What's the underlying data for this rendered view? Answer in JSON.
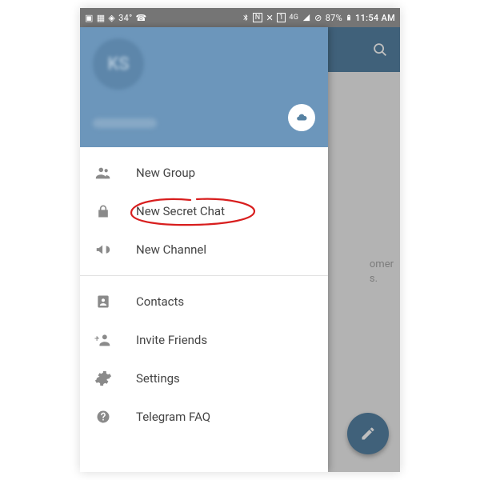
{
  "statusbar": {
    "left_icons": [
      "app-icon",
      "image-icon",
      "shield-icon",
      "temp-34",
      "phone-icon"
    ],
    "temp_text": "34°",
    "right": {
      "bt": "bluetooth-icon",
      "nfc_label": "N",
      "vibrate": "vibrate-icon",
      "data_label": "1",
      "signal_label": "4G",
      "signal": "signal-icon",
      "noloc": "location-off-icon",
      "battery_text": "87%",
      "battery": "battery-icon",
      "time": "11:54 AM"
    }
  },
  "appbar": {
    "search_icon": "search-icon"
  },
  "underlay": {
    "line1": "omer",
    "line2": "s."
  },
  "drawer": {
    "avatar_initials": "KS",
    "cloud_icon": "cloud-icon",
    "items": [
      {
        "icon": "group-icon",
        "label": "New Group"
      },
      {
        "icon": "lock-icon",
        "label": "New Secret Chat"
      },
      {
        "icon": "megaphone-icon",
        "label": "New Channel"
      }
    ],
    "items2": [
      {
        "icon": "contact-icon",
        "label": "Contacts"
      },
      {
        "icon": "add-person-icon",
        "label": "Invite Friends"
      },
      {
        "icon": "gear-icon",
        "label": "Settings"
      },
      {
        "icon": "help-icon",
        "label": "Telegram FAQ"
      }
    ]
  },
  "fab": {
    "icon": "pencil-icon"
  },
  "colors": {
    "accent": "#5682a3",
    "annotation": "#d81e1e"
  }
}
